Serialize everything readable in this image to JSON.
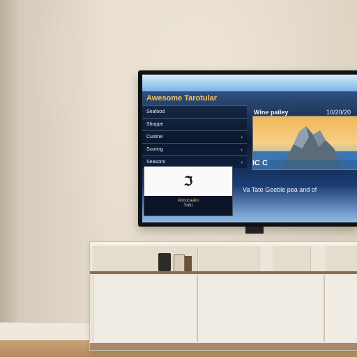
{
  "tv_screen": {
    "app_title": "Awesome Tarotular",
    "menu": [
      {
        "label": "Seafood",
        "arrow": ""
      },
      {
        "label": "Shoppe",
        "arrow": ""
      },
      {
        "label": "Cuisine",
        "arrow": "‹"
      },
      {
        "label": "Scoring",
        "arrow": "‹"
      },
      {
        "label": "Seasons",
        "arrow": "‹"
      }
    ],
    "featured": {
      "label": "Wine pailey",
      "date": "10/20/20",
      "caption": "IC C"
    },
    "card": {
      "logo": "ℑ",
      "title": "Aboucaalio",
      "subtitle": "Sofu"
    },
    "tagline": "Va Tate Geeble pea and of"
  },
  "colors": {
    "title_accent": "#f4c462",
    "screen_dark": "#0f1b33"
  }
}
